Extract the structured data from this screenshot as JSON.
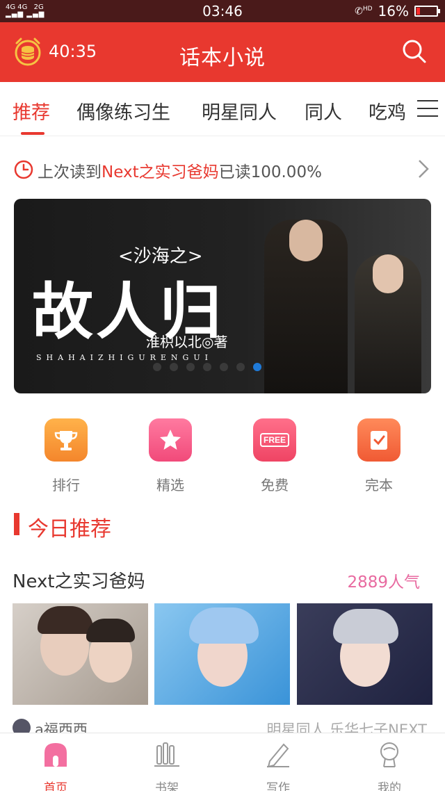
{
  "status_bar": {
    "signal_left": "4G 4G",
    "signal_right": "2G",
    "time": "03:46",
    "hd": "HD",
    "battery_percent": "16%",
    "battery_level": 0.16
  },
  "header": {
    "timer": "40:35",
    "title": "话本小说"
  },
  "tabs": [
    {
      "label": "推荐",
      "active": true
    },
    {
      "label": "偶像练习生"
    },
    {
      "label": "明星同人"
    },
    {
      "label": "同人"
    },
    {
      "label": "吃鸡"
    }
  ],
  "last_read": {
    "prefix": "上次读到",
    "book": "Next之实习爸妈",
    "suffix": "已读100.00%"
  },
  "banner": {
    "subtitle": "<沙海之>",
    "title": "故人归",
    "author": "淮枳以北◎著",
    "roman": "SHAHAIZHIGURENGUI",
    "dots": 7,
    "active_dot": 6
  },
  "quick_links": [
    {
      "label": "排行",
      "icon": "trophy-icon"
    },
    {
      "label": "精选",
      "icon": "star-icon"
    },
    {
      "label": "免费",
      "icon": "free-icon",
      "badge": "FREE"
    },
    {
      "label": "完本",
      "icon": "checklist-icon"
    }
  ],
  "section": {
    "title": "今日推荐"
  },
  "featured": {
    "title": "Next之实习爸妈",
    "popularity": "2889人气",
    "user": "a福西西",
    "tags": "明星同人   乐华七子NEXT"
  },
  "bottom_nav": [
    {
      "label": "首页",
      "icon": "home-icon",
      "active": true
    },
    {
      "label": "书架",
      "icon": "bookshelf-icon"
    },
    {
      "label": "写作",
      "icon": "pen-icon"
    },
    {
      "label": "我的",
      "icon": "profile-icon"
    }
  ],
  "colors": {
    "brand_red": "#e8382f",
    "pink": "#e86aa0",
    "active_dot": "#1f7ad8"
  }
}
